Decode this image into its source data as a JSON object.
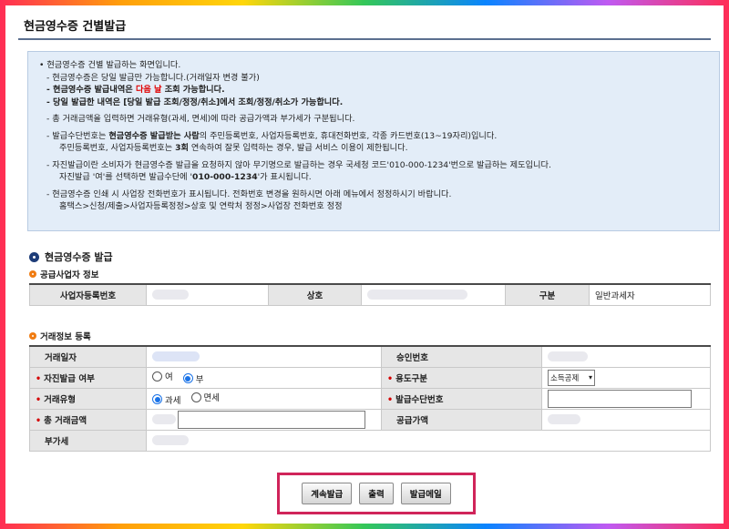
{
  "page": {
    "title": "현금영수증 건별발급"
  },
  "notice": {
    "intro": "현금영수증 건별 발급하는 화면입니다.",
    "l1": "- 현금영수증은 당일 발급만 가능합니다.(거래일자 변경 불가)",
    "l2_a": "- 현금영수증 발급내역은 ",
    "l2_red": "다음 날",
    "l2_b": " 조회 가능합니다.",
    "l3": "- 당일 발급한 내역은 [당일 발급 조회/정정/취소]에서 조회/정정/취소가 가능합니다.",
    "l4": "- 총 거래금액을 입력하면 거래유형(과세, 면세)에 따라 공급가액과 부가세가 구분됩니다.",
    "l5_a": "- 발급수단번호는 ",
    "l5_b": "현금영수증 발급받는 사람",
    "l5_c": "의  주민등록번호, 사업자등록번호, 휴대전화번호, 각종 카드번호(13~19자리)입니다.",
    "l5_sub_a": "주민등록번호, 사업자등록번호는 ",
    "l5_sub_b": "3회",
    "l5_sub_c": " 연속하여 잘못 입력하는 경우, 발급 서비스 이용이 제한됩니다.",
    "l6": "- 자진발급이란 소비자가 현금영수증 발급을 요청하지 않아 무기명으로 발급하는 경우 국세청 코드'010-000-1234'번으로 발급하는 제도입니다.",
    "l6_sub_a": "자진발급 '여'를 선택하면 발급수단에 '",
    "l6_sub_b": "010-000-1234",
    "l6_sub_c": "'가 표시됩니다.",
    "l7": "- 현금영수증 인쇄 시 사업장 전화번호가 표시됩니다. 전화번호 변경을 원하시면 아래 메뉴에서 정정하시기 바랍니다.",
    "l7_sub": "홈택스>신청/제출>사업자등록정정>상호 및 연락처 정정>사업장 전화번호 정정"
  },
  "section": {
    "title": "현금영수증 발급",
    "supplier_title": "공급사업자 정보",
    "txn_title": "거래정보 등록"
  },
  "supplier": {
    "biz_no_label": "사업자등록번호",
    "name_label": "상호",
    "type_label": "구분",
    "type_value": "일반과세자"
  },
  "txn": {
    "date_label": "거래일자",
    "approval_label": "승인번호",
    "self_issue_label": "자진발급 여부",
    "self_yes": "여",
    "self_no": "부",
    "usage_label": "용도구분",
    "usage_value": "소득공제",
    "txn_type_label": "거래유형",
    "taxable": "과세",
    "exempt": "면세",
    "means_label": "발급수단번호",
    "total_label": "총 거래금액",
    "supply_label": "공급가액",
    "vat_label": "부가세",
    "req_mark": "•"
  },
  "buttons": {
    "continue": "계속발급",
    "print": "출력",
    "mail": "발급메일"
  },
  "colors": {
    "accent_navy": "#1d3c78",
    "bullet_orange": "#f07c12",
    "required_red": "#d40000",
    "highlight_border": "#d0245a"
  }
}
